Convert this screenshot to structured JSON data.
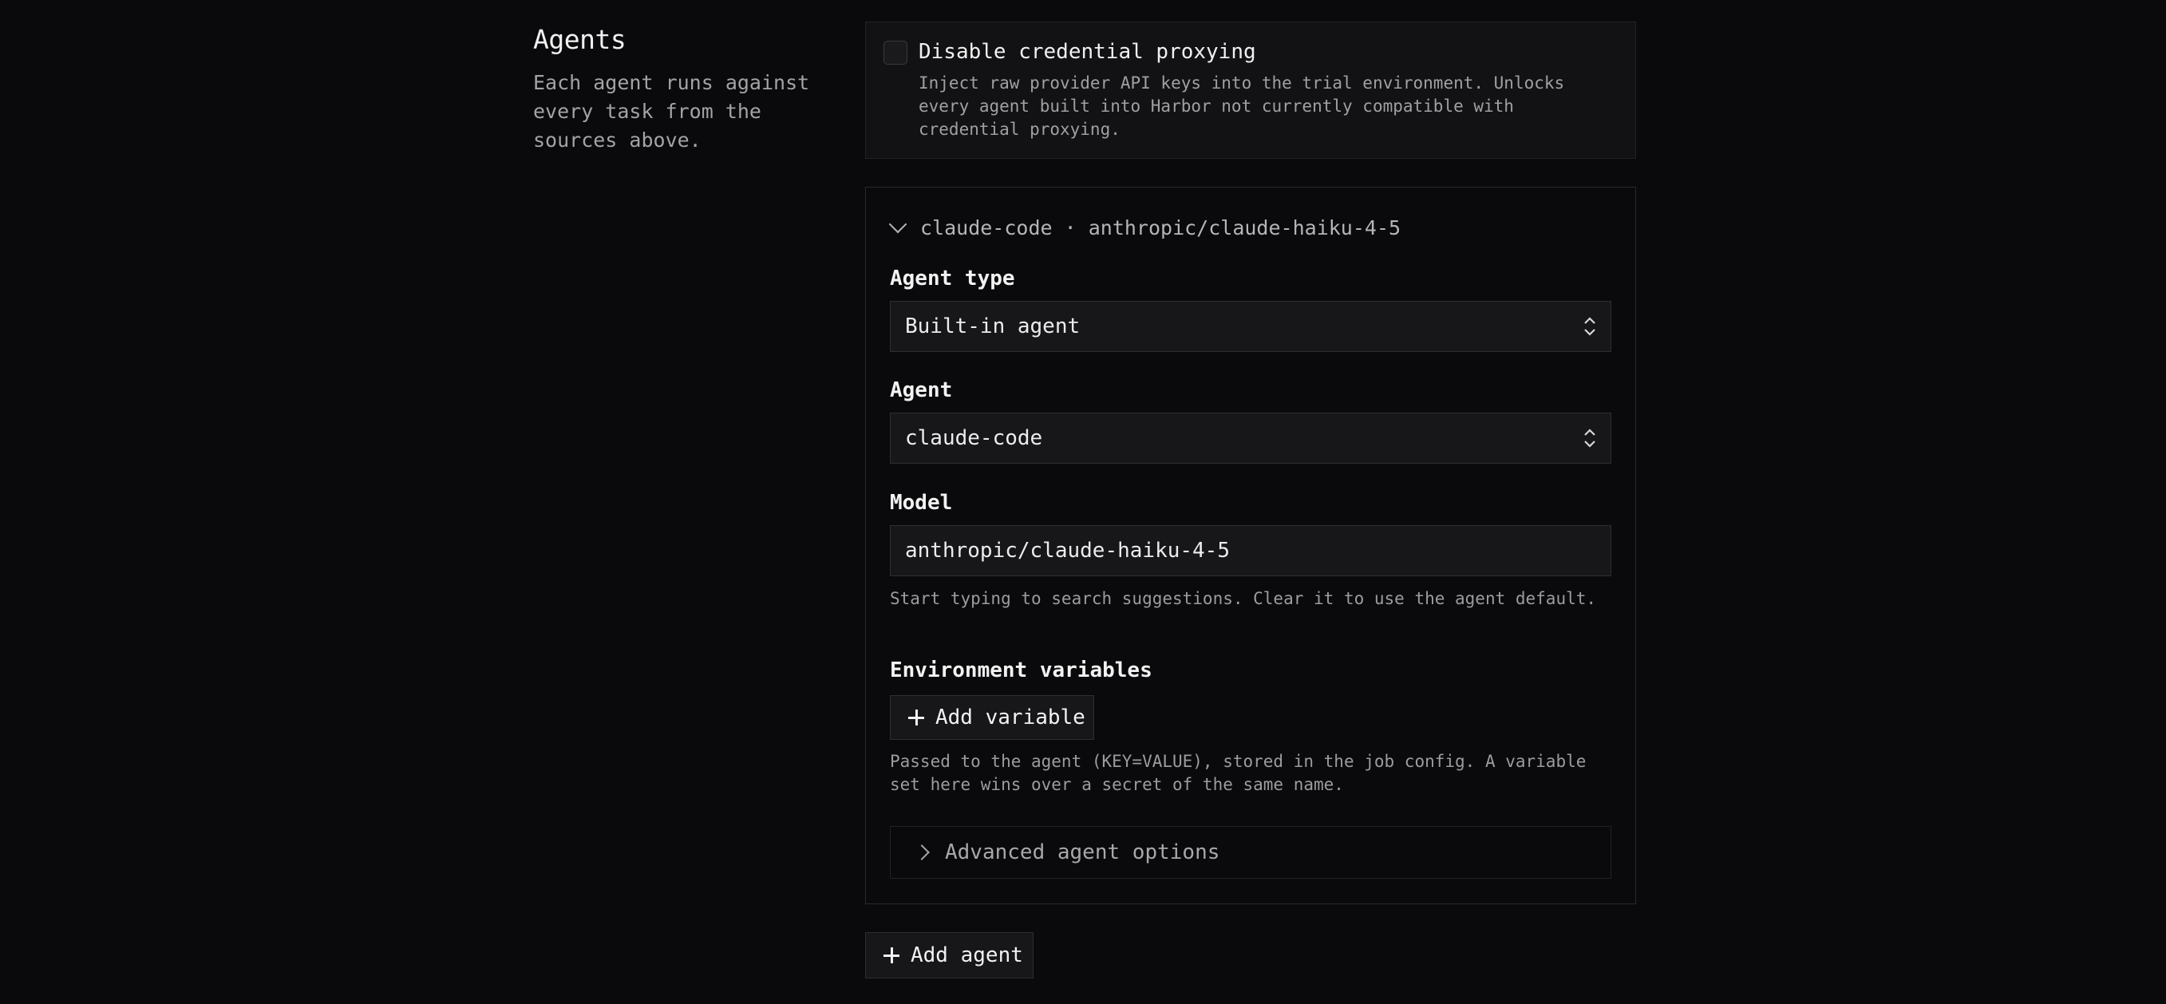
{
  "agents_section": {
    "title": "Agents",
    "description": "Each agent runs against every task from the sources above."
  },
  "credential_proxy": {
    "checked": false,
    "label": "Disable credential proxying",
    "description": "Inject raw provider API keys into the trial environment. Unlocks every agent built into Harbor not currently compatible with credential proxying."
  },
  "agent_card": {
    "header": "claude-code · anthropic/claude-haiku-4-5",
    "agent_type": {
      "label": "Agent type",
      "value": "Built-in agent"
    },
    "agent": {
      "label": "Agent",
      "value": "claude-code"
    },
    "model": {
      "label": "Model",
      "value": "anthropic/claude-haiku-4-5",
      "help": "Start typing to search suggestions. Clear it to use the agent default."
    },
    "env_vars": {
      "label": "Environment variables",
      "add_button": "Add variable",
      "help": "Passed to the agent (KEY=VALUE), stored in the job config. A variable set here wins over a secret of the same name."
    },
    "advanced": {
      "label": "Advanced agent options"
    }
  },
  "add_agent_button": "Add agent"
}
